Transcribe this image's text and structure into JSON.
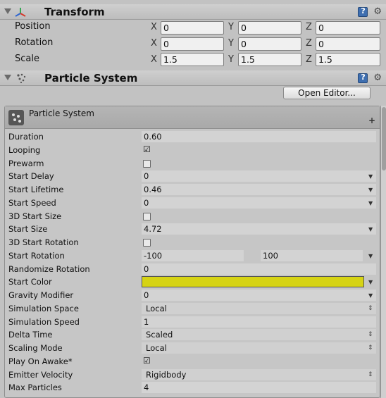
{
  "transform": {
    "title": "Transform",
    "rows": [
      {
        "label": "Position",
        "x": "0",
        "y": "0",
        "z": "0"
      },
      {
        "label": "Rotation",
        "x": "0",
        "y": "0",
        "z": "0"
      },
      {
        "label": "Scale",
        "x": "1.5",
        "y": "1.5",
        "z": "1.5"
      }
    ],
    "axis": {
      "x": "X",
      "y": "Y",
      "z": "Z"
    }
  },
  "particle_system": {
    "title": "Particle System",
    "open_editor_label": "Open Editor...",
    "module_title": "Particle System",
    "props": {
      "duration": {
        "label": "Duration",
        "value": "0.60"
      },
      "looping": {
        "label": "Looping",
        "checked": true
      },
      "prewarm": {
        "label": "Prewarm",
        "checked": false
      },
      "start_delay": {
        "label": "Start Delay",
        "value": "0"
      },
      "start_lifetime": {
        "label": "Start Lifetime",
        "value": "0.46"
      },
      "start_speed": {
        "label": "Start Speed",
        "value": "0"
      },
      "three_d_start_size": {
        "label": "3D Start Size",
        "checked": false
      },
      "start_size": {
        "label": "Start Size",
        "value": "4.72"
      },
      "three_d_start_rotation": {
        "label": "3D Start Rotation",
        "checked": false
      },
      "start_rotation": {
        "label": "Start Rotation",
        "min": "-100",
        "max": "100"
      },
      "randomize_rotation": {
        "label": "Randomize Rotation",
        "value": "0"
      },
      "start_color": {
        "label": "Start Color",
        "color": "#d6d314"
      },
      "gravity_modifier": {
        "label": "Gravity Modifier",
        "value": "0"
      },
      "simulation_space": {
        "label": "Simulation Space",
        "value": "Local"
      },
      "simulation_speed": {
        "label": "Simulation Speed",
        "value": "1"
      },
      "delta_time": {
        "label": "Delta Time",
        "value": "Scaled"
      },
      "scaling_mode": {
        "label": "Scaling Mode",
        "value": "Local"
      },
      "play_on_awake": {
        "label": "Play On Awake*",
        "checked": true
      },
      "emitter_velocity": {
        "label": "Emitter Velocity",
        "value": "Rigidbody"
      },
      "max_particles": {
        "label": "Max Particles",
        "value": "4"
      }
    }
  },
  "icons": {
    "transform": "transform-axes-icon",
    "particle": "particle-system-icon",
    "help": "help-book-icon",
    "settings": "gear-icon"
  }
}
